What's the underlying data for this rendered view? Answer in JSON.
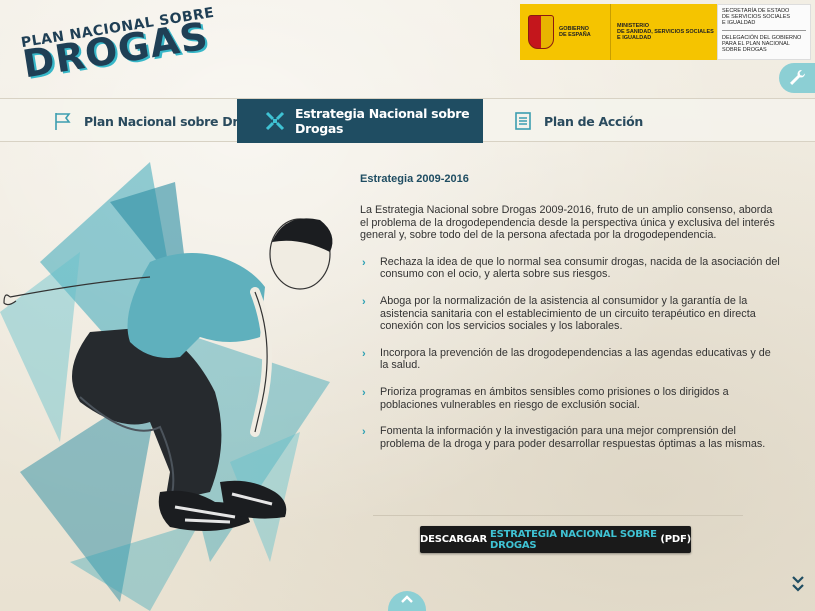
{
  "header": {
    "logo_line1": "PLAN NACIONAL SOBRE",
    "logo_line2": "DROGAS",
    "gov_logo": {
      "gobierno": [
        "GOBIERNO",
        "DE ESPAÑA"
      ],
      "ministerio": [
        "MINISTERIO",
        "DE SANIDAD, SERVICIOS SOCIALES",
        "E IGUALDAD"
      ],
      "secretaria": [
        "SECRETARÍA DE ESTADO",
        "DE SERVICIOS SOCIALES",
        "E IGUALDAD"
      ],
      "delegacion": [
        "DELEGACIÓN DEL GOBIERNO",
        "PARA EL PLAN NACIONAL SOBRE DROGAS"
      ]
    },
    "tools_icon": "wrench-icon"
  },
  "tabs": [
    {
      "label": "Plan Nacional sobre Drogas",
      "icon": "flag-icon",
      "active": false
    },
    {
      "label": "Estrategia Nacional sobre Drogas",
      "icon": "cross-arrows-icon",
      "active": true
    },
    {
      "label": "Plan de Acción",
      "icon": "document-icon",
      "active": false
    }
  ],
  "content": {
    "heading": "Estrategia 2009-2016",
    "intro": "La Estrategia Nacional sobre Drogas 2009-2016, fruto de un amplio consenso, aborda el problema de la drogodependencia desde la perspectiva única y exclusiva del interés general y, sobre todo del de la persona afectada por la drogodependencia.",
    "bullets": [
      "Rechaza la idea de que lo normal sea consumir drogas, nacida de la asociación del consumo con el ocio, y alerta sobre sus riesgos.",
      "Aboga por la normalización de la asistencia al consumidor y la garantía de la asistencia sanitaria con el establecimiento de un circuito terapéutico en directa conexión con los servicios sociales y los laborales.",
      "Incorpora la prevención de las drogodependencias a las agendas educativas y de la salud.",
      "Prioriza programas en ámbitos sensibles como prisiones o los dirigidos a poblaciones vulnerables en riesgo de exclusión social.",
      "Fomenta la información y la investigación para una mejor comprensión del problema de la droga y para poder desarrollar respuestas óptimas a las mismas."
    ]
  },
  "download": {
    "prefix": "DESCARGAR",
    "highlight": "ESTRATEGIA NACIONAL SOBRE DROGAS",
    "suffix": "(PDF)"
  },
  "nav": {
    "up_icon": "chevron-up-icon",
    "down_icon": "double-chevron-down-icon"
  },
  "colors": {
    "accent": "#3fc3d4",
    "dark_blue": "#1f4d62",
    "gov_yellow": "#f5c400"
  }
}
